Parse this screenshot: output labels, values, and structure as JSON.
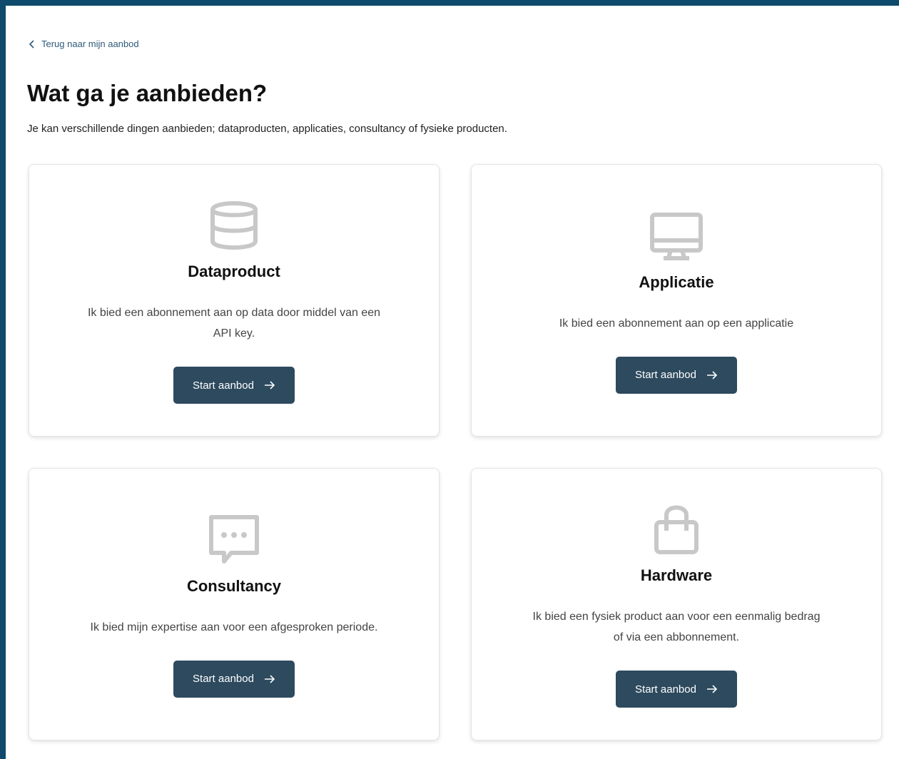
{
  "nav": {
    "back_label": "Terug naar mijn aanbod"
  },
  "header": {
    "title": "Wat ga je aanbieden?",
    "subtitle": "Je kan verschillende dingen aanbieden; dataproducten, applicaties, consultancy of fysieke producten."
  },
  "cards": [
    {
      "icon": "database-icon",
      "title": "Dataproduct",
      "description": "Ik bied een abonnement aan op data door middel van een API key.",
      "button_label": "Start aanbod"
    },
    {
      "icon": "monitor-icon",
      "title": "Applicatie",
      "description": "Ik bied een abonnement aan op een applicatie",
      "button_label": "Start aanbod"
    },
    {
      "icon": "chat-bubble-icon",
      "title": "Consultancy",
      "description": "Ik bied mijn expertise aan voor een afgesproken periode.",
      "button_label": "Start aanbod"
    },
    {
      "icon": "shopping-bag-icon",
      "title": "Hardware",
      "description": "Ik bied een fysiek product aan voor een eenmalig bedrag of via een abbonnement.",
      "button_label": "Start aanbod"
    }
  ],
  "colors": {
    "frame": "#0d4a6b",
    "button": "#2d4a5e",
    "link": "#2e5a7a",
    "icon": "#c8c8c8"
  }
}
